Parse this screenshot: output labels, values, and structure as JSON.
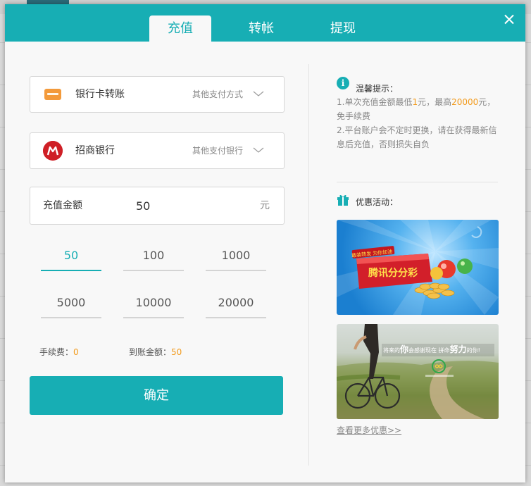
{
  "tabs": [
    {
      "label": "充值",
      "active": true
    },
    {
      "label": "转帐",
      "active": false
    },
    {
      "label": "提现",
      "active": false
    }
  ],
  "close_icon": "close-icon",
  "payment_method": {
    "label": "银行卡转账",
    "other": "其他支付方式",
    "icon": "bank-card-icon"
  },
  "bank": {
    "label": "招商银行",
    "other": "其他支付银行",
    "icon": "cmb-logo"
  },
  "amount": {
    "label": "充值金额",
    "value": "50",
    "unit": "元"
  },
  "quick_amounts": [
    "50",
    "100",
    "1000",
    "5000",
    "10000",
    "20000"
  ],
  "selected_quick": "50",
  "fee": {
    "label": "手续费：",
    "value": "0"
  },
  "arrival": {
    "label": "到账金额：",
    "value": "50"
  },
  "confirm_label": "确定",
  "tips": {
    "title": "温馨提示：",
    "line1_a": "1.单次充值金额最低",
    "line1_min": "1",
    "line1_b": "元，最高",
    "line1_max": "20000",
    "line1_c": "元，免手续费",
    "line2": "2.平台账户会不定时更换，请在获得最新信息后充值，否则损失自负"
  },
  "promo": {
    "title": "优惠活动：",
    "banner1_text": "腾讯分分彩",
    "banner1_small": "敢装转发 为你加油",
    "banner2_text_a": "将来的",
    "banner2_text_b": "你",
    "banner2_text_c": "会感谢现在 拼命",
    "banner2_text_d": "努力",
    "banner2_text_e": "的你!",
    "more": "查看更多优惠>>"
  },
  "colors": {
    "accent": "#17aeb4",
    "highlight": "#f29a1b"
  }
}
